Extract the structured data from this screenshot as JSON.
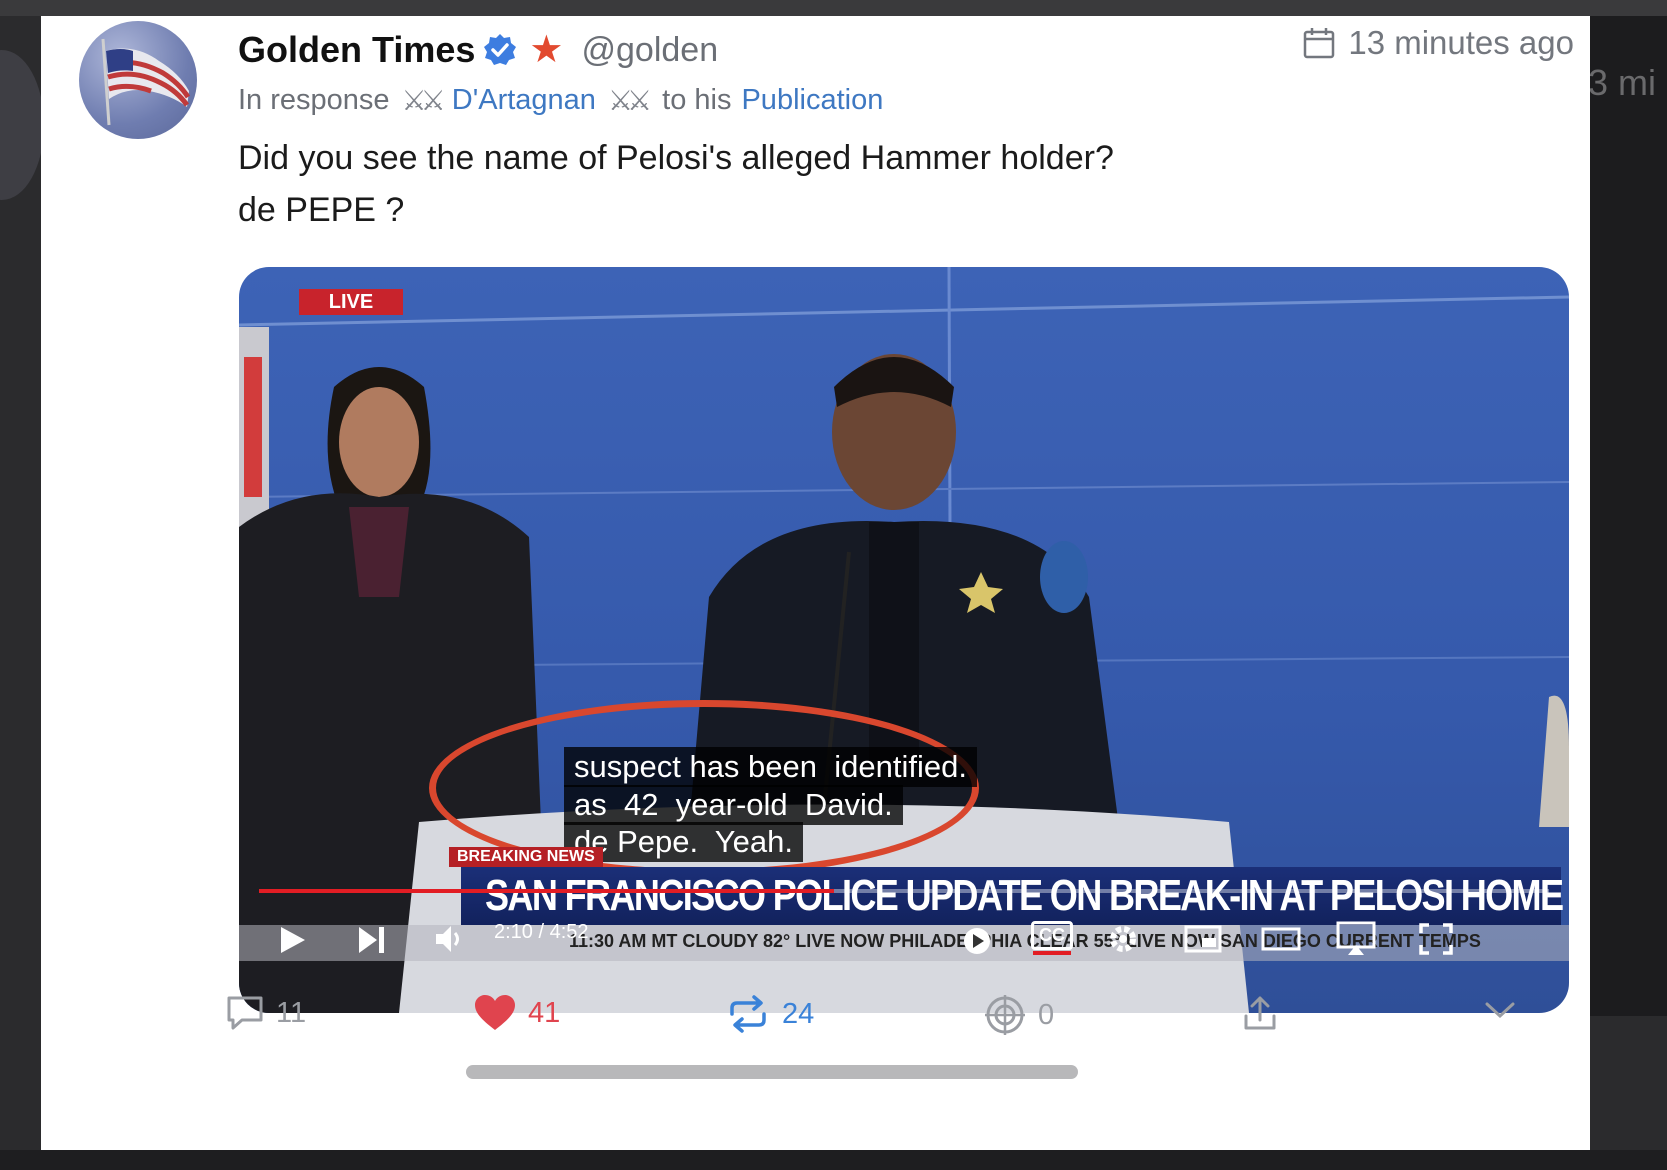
{
  "post": {
    "display_name": "Golden Times",
    "handle": "@golden",
    "reply_prefix": "In response",
    "reply_swords_left": "⚔⚔",
    "reply_user": "D'Artagnan",
    "reply_swords_right": "⚔⚔",
    "reply_mid": "to his",
    "reply_target": "Publication",
    "timestamp": "13 minutes ago",
    "text_line1": "Did you see the name of Pelosi's alleged Hammer holder?",
    "text_line2": "de PEPE ?"
  },
  "video": {
    "live_label": "LIVE",
    "breaking_label": "BREAKING NEWS",
    "caption_line1": "suspect has been  identified.",
    "caption_line2": "as  42  year-old  David.",
    "caption_line3": "de Pepe.  Yeah.",
    "headline": "SAN FRANCISCO POLICE UPDATE ON BREAK-IN AT PELOSI HOME",
    "ticker": "11:30 AM MT    CLOUDY 82°    LIVE NOW    PHILADELPHIA    CLEAR 55°    LIVE NOW    SAN DIEGO    CURRENT TEMPS",
    "time_display": "2:10 / 4:52",
    "progress": 0.446,
    "cc_label": "CC"
  },
  "actions": {
    "replies": "11",
    "likes": "41",
    "reposts": "24",
    "quotes": "0"
  },
  "colors": {
    "accent_link": "#3e78c2",
    "like_red": "#e0444e",
    "repost_blue": "#3a82d8",
    "star": "#e24a2f",
    "annotation_oval": "#d9472e"
  },
  "background": {
    "ghost_time": "3 mi"
  }
}
